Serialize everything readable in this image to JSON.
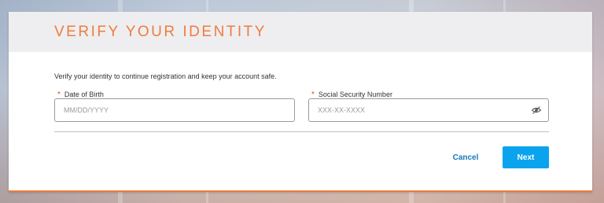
{
  "header": {
    "title": "VERIFY YOUR IDENTITY"
  },
  "form": {
    "intro": "Verify your identity to continue registration and keep your account safe.",
    "required_marker": "*",
    "dob": {
      "label": "Date of Birth",
      "placeholder": "MM/DD/YYYY",
      "value": ""
    },
    "ssn": {
      "label": "Social Security Number",
      "placeholder": "XXX-XX-XXXX",
      "value": "",
      "toggle_icon": "eye-slash-icon"
    }
  },
  "actions": {
    "cancel_label": "Cancel",
    "next_label": "Next"
  },
  "colors": {
    "title": "#ef7c3f",
    "accent_border": "#e87b3c",
    "required": "#e2462c",
    "cancel": "#1679b8",
    "next_bg": "#0aa4ee"
  }
}
